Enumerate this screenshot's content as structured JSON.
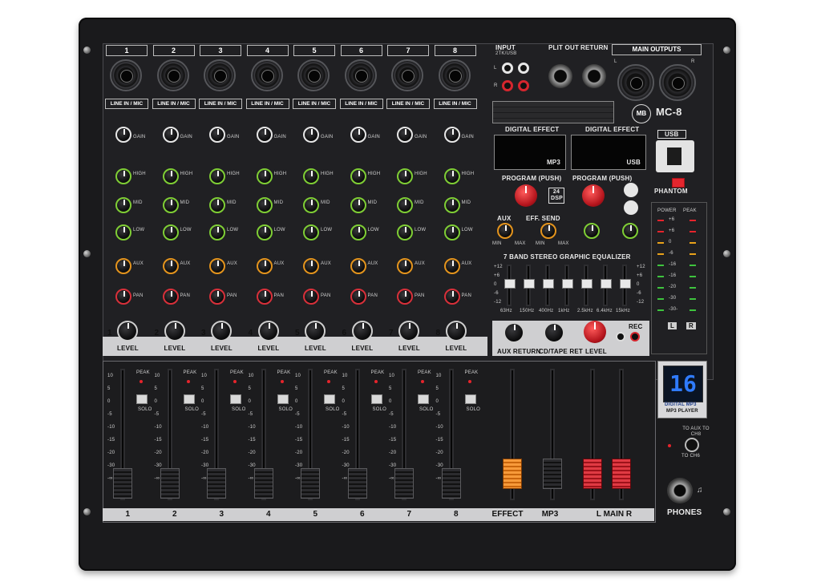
{
  "model": "MC-8",
  "brand_mark": "MB",
  "channels": [
    {
      "number": "1"
    },
    {
      "number": "2"
    },
    {
      "number": "3"
    },
    {
      "number": "4"
    },
    {
      "number": "5"
    },
    {
      "number": "6"
    },
    {
      "number": "7"
    },
    {
      "number": "8"
    }
  ],
  "input_label": "LINE IN / MIC",
  "knob_labels": {
    "gain": "GAIN",
    "high": "HIGH",
    "mid": "MID",
    "low": "LOW",
    "aux": "AUX",
    "pan": "PAN",
    "level": "LEVEL"
  },
  "io": {
    "input": "INPUT",
    "twotk": "2TK/USB",
    "split_out": "PLIT OUT",
    "return": "RETURN",
    "main_outputs": "MAIN OUTPUTS",
    "l": "L",
    "r": "R"
  },
  "effects": {
    "digital_effect": "DIGITAL EFFECT",
    "screen1": "MP3",
    "screen2": "USB",
    "program": "PROGRAM (PUSH)",
    "dsp": "24 DSP",
    "aux": "AUX",
    "eff_send": "EFF. SEND",
    "min": "MIN",
    "max": "MAX"
  },
  "usb": "USB",
  "phantom": "PHANTOM",
  "meter": {
    "power": "POWER",
    "peak": "PEAK",
    "scale": [
      "+6",
      "+6",
      "0",
      "-6",
      "-16",
      "-16",
      "-20",
      "-30",
      "-30-"
    ],
    "left": "L",
    "right": "R"
  },
  "eq": {
    "title": "7 BAND STEREO GRAPHIC EQUALIZER",
    "bands": [
      "63Hz",
      "150Hz",
      "400Hz",
      "1kHz",
      "2.5kHz",
      "6.4kHz",
      "15kHz"
    ],
    "scale": [
      "+12",
      "+6",
      "0",
      "-6",
      "-12"
    ]
  },
  "returns": {
    "aux_return": "AUX RETURN",
    "cd_tape_ret": "CD/TAPE RET",
    "level": "LEVEL",
    "rec": "REC"
  },
  "fader_labels": {
    "peak": "PEAK",
    "solo": "SOLO",
    "scale": [
      "10",
      "5",
      "0",
      "-5",
      "-10",
      "-15",
      "-20",
      "-30",
      "-∞"
    ]
  },
  "bottom": {
    "effect": "EFFECT",
    "mp3": "MP3",
    "main": "L  MAIN  R"
  },
  "player": {
    "display": "16",
    "line1": "DIGITAL MP3",
    "line2": "MP3 PLAYER"
  },
  "to_aux": "TO AUX TO CH8",
  "to_ch6": "TO CH6",
  "phones": "PHONES",
  "colors": {
    "body": "#1a1a1c",
    "eq_knob": "#7fce35",
    "aux_knob": "#e4941d",
    "pan_knob": "#d8303a",
    "effect_fader": "#e6801f",
    "main_fader": "#c9202a",
    "display": "#2f7bff"
  }
}
